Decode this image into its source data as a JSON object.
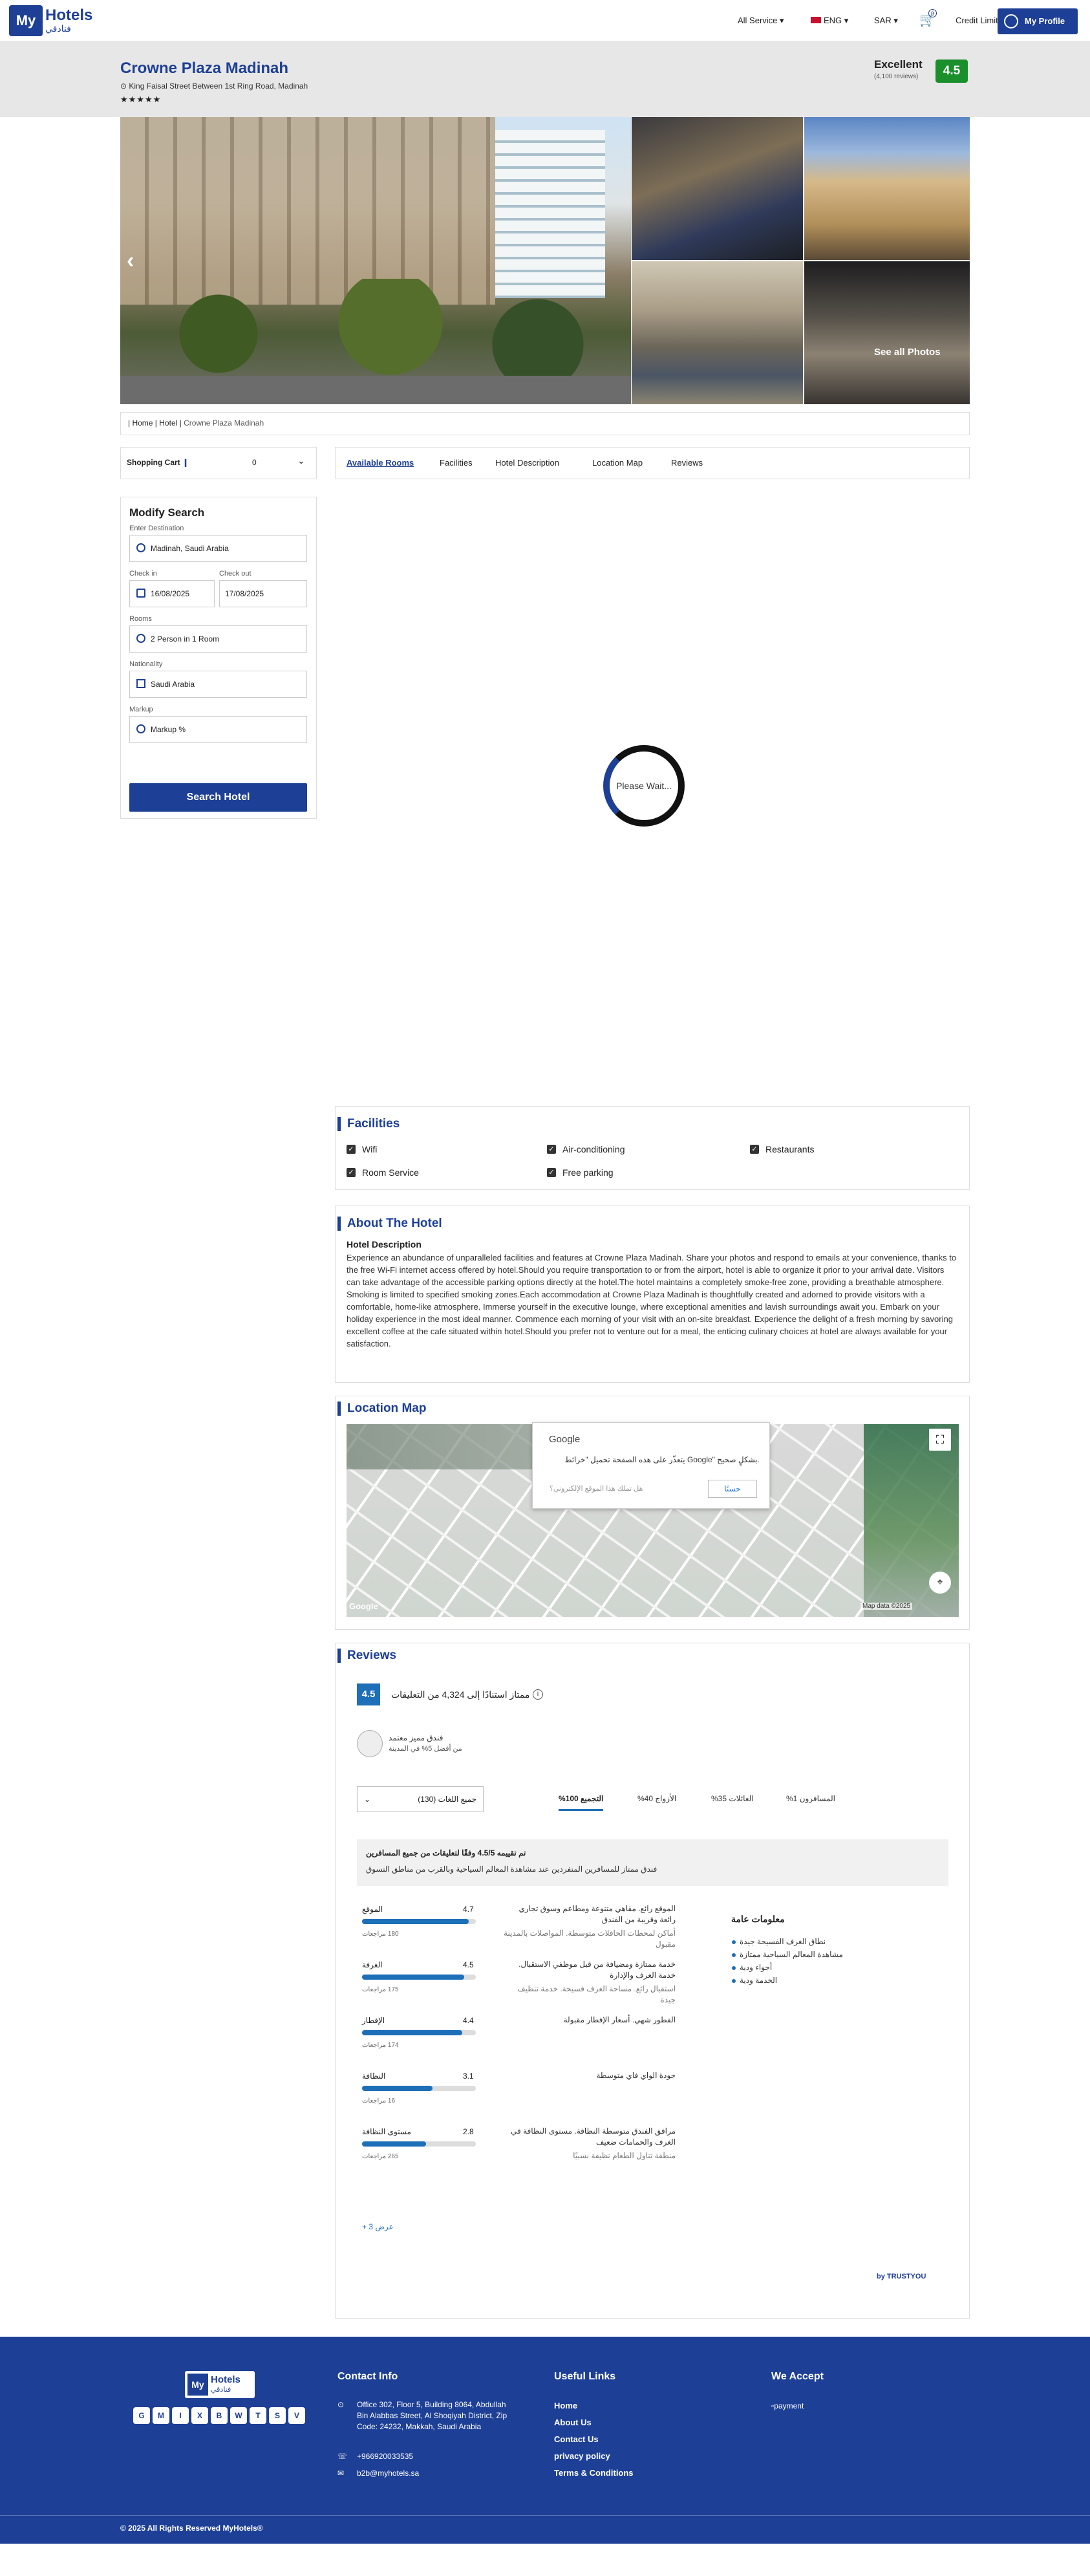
{
  "header": {
    "logo_main": "My",
    "logo_brand": "Hotels",
    "logo_arabic": "فنادقي",
    "nav": [
      "All Service",
      "ENG",
      "SAR",
      "Credit Limit"
    ],
    "cart_count": "0",
    "profile_label": "My Profile"
  },
  "hotel": {
    "name": "Crowne Plaza Madinah",
    "address": "King Faisal Street Between 1st Ring Road, Madinah",
    "stars": "★★★★★",
    "rating_word": "Excellent",
    "rating_sub": "(4,100 reviews)",
    "rating_score": "4.5",
    "see_all_photos": "See all Photos"
  },
  "breadcrumb": [
    "Home",
    "Hotel",
    "Crowne Plaza Madinah"
  ],
  "cart": {
    "label": "Shopping Cart",
    "count": "0"
  },
  "search": {
    "title": "Modify Search",
    "destination_label": "Enter Destination",
    "destination": "Madinah, Saudi Arabia",
    "checkin_label": "Check in",
    "checkin": "16/08/2025",
    "checkout_label": "Check out",
    "checkout": "17/08/2025",
    "rooms_label": "Rooms",
    "rooms": "2 Person in 1 Room",
    "nationality_label": "Nationality",
    "nationality": "Saudi Arabia",
    "markup_label": "Markup",
    "markup": "Markup %",
    "button": "Search Hotel"
  },
  "tabs": [
    "Available Rooms",
    "Facilities",
    "Hotel Description",
    "Location Map",
    "Reviews"
  ],
  "loading_text": "Please Wait...",
  "facilities": {
    "title": "Facilities",
    "items": [
      "Wifi",
      "Air-conditioning",
      "Restaurants",
      "Room Service",
      "Free parking"
    ]
  },
  "about": {
    "title": "About The Hotel",
    "subtitle": "Hotel Description",
    "text": "Experience an abundance of unparalleled facilities and features at Crowne Plaza Madinah. Share your photos and respond to emails at your convenience, thanks to the free Wi-Fi internet access offered by hotel.Should you require transportation to or from the airport, hotel is able to organize it prior to your arrival date. Visitors can take advantage of the accessible parking options directly at the hotel.The hotel maintains a completely smoke-free zone, providing a breathable atmosphere. Smoking is limited to specified smoking zones.Each accommodation at Crowne Plaza Madinah is thoughtfully created and adorned to provide visitors with a comfortable, home-like atmosphere. Immerse yourself in the executive lounge, where exceptional amenities and lavish surroundings await you. Embark on your holiday experience in the most ideal manner. Commence each morning of your visit with an on-site breakfast. Experience the delight of a fresh morning by savoring excellent coffee at the cafe situated within hotel.Should you prefer not to venture out for a meal, the enticing culinary choices at hotel are always available for your satisfaction."
  },
  "map": {
    "title": "Location Map",
    "dialog_title": "Google",
    "dialog_msg": "يتعذّر على هذه الصفحة تحميل \"خرائط Google\" بشكلٍ صحيح.",
    "dialog_dim": "هل تملك هذا الموقع الإلكتروني؟",
    "dialog_ok": "حسنًا",
    "map_data": "Map data ©2025",
    "google_logo": "Google"
  },
  "reviews": {
    "title": "Reviews",
    "score": "4.5",
    "summary": "ممتاز استنادًا إلى 4,324 من التعليقات",
    "cert_line1": "فندق مميز معتمد",
    "cert_line2": "من أفضل 5% في المدينة",
    "select": "جميع اللغات (130)",
    "tabs": [
      "التجميع 100%",
      "الأزواج 40%",
      "العائلات 35%",
      "المسافرون 1%"
    ],
    "box_line1": "تم تقييمه 4.5/5 وفقًا لتعليقات من جميع المسافرين",
    "box_line2": "فندق ممتاز للمسافرين المنفردين عند مشاهدة المعالم السياحية وبالقرب من مناطق التسوق",
    "categories": [
      {
        "name": "الموقع",
        "score": "4.7",
        "count": "180 مراجعات",
        "pct": 0.94,
        "desc": "الموقع رائع. مقاهي متنوعة ومطاعم وسوق تجاري رائعة وقريبة من الفندق",
        "desc2": "أماكن لمحطات الحافلات متوسطة. المواصلات بالمدينة مقبول"
      },
      {
        "name": "الغرفة",
        "score": "4.5",
        "count": "175 مراجعات",
        "pct": 0.9,
        "desc": "خدمة ممتازة ومضيافة من قبل موظفي الاستقبال. خدمة الغرف والإدارة",
        "desc2": "استقبال رائع. مساحة الغرف فسيحة. خدمة تنظيف جيدة"
      },
      {
        "name": "الإفطار",
        "score": "4.4",
        "count": "174 مراجعات",
        "pct": 0.88,
        "desc": "الفطور شهي. أسعار الإفطار مقبولة",
        "desc2": ""
      },
      {
        "name": "النظافة",
        "score": "3.1",
        "count": "16 مراجعات",
        "pct": 0.62,
        "desc": "جودة الواي فاي متوسطة",
        "desc2": ""
      },
      {
        "name": "مستوى النظافة",
        "score": "2.8",
        "count": "265 مراجعات",
        "pct": 0.56,
        "desc": "مرافق الفندق متوسطة النظافة. مستوى النظافة في الغرف والحمامات ضعيف",
        "desc2": "منطقة تناول الطعام نظيفة نسبيًا"
      }
    ],
    "general_title": "معلومات عامة",
    "general_items": [
      "نطاق الغرف الفسيحة جيدة",
      "مشاهدة المعالم السياحية ممتازة",
      "أجواء ودية",
      "الخدمة ودية"
    ],
    "more": "+ 3 عرض",
    "trustyou": "by TRUSTYOU"
  },
  "footer": {
    "contact_title": "Contact Info",
    "address": "Office 302, Floor 5, Building 8064, Abdullah Bin Alabbas Street, Al Shoqiyah District, Zip Code: 24232, Makkah, Saudi Arabia",
    "phone": "+966920033535",
    "email": "b2b@myhotels.sa",
    "links_title": "Useful Links",
    "links": [
      "Home",
      "About Us",
      "Contact Us",
      "privacy policy",
      "Terms & Conditions"
    ],
    "accept_title": "We Accept",
    "payment_alt": "payment",
    "social": [
      "G",
      "M",
      "I",
      "X",
      "B",
      "W",
      "T",
      "S",
      "V"
    ],
    "copyright": "© 2025 All Rights Reserved MyHotels®"
  }
}
